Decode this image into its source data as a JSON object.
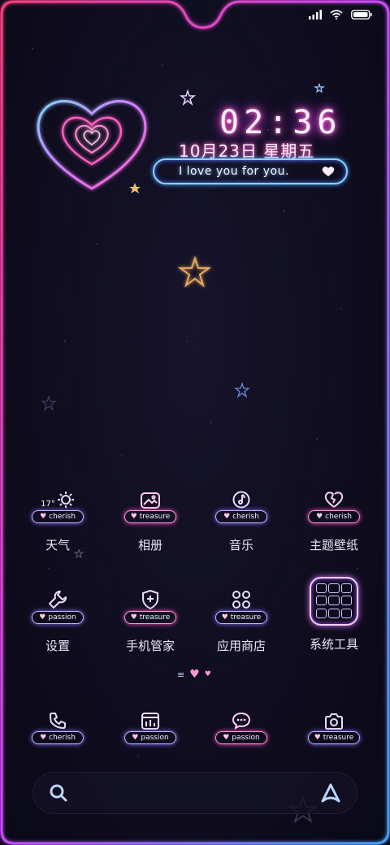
{
  "lock": {
    "time": "02:36",
    "date": "10月23日  星期五",
    "bubble_text": "I love you for you."
  },
  "weather": {
    "temp": "17°"
  },
  "apps_row1": [
    {
      "label": "天气",
      "tag": "cherish",
      "icon": "sun-icon"
    },
    {
      "label": "相册",
      "tag": "treasure",
      "icon": "image-icon"
    },
    {
      "label": "音乐",
      "tag": "cherish",
      "icon": "music-note-icon"
    },
    {
      "label": "主题壁纸",
      "tag": "cherish",
      "icon": "broken-heart-icon"
    }
  ],
  "apps_row2": [
    {
      "label": "设置",
      "tag": "passion",
      "icon": "wrench-icon"
    },
    {
      "label": "手机管家",
      "tag": "treasure",
      "icon": "shield-plus-icon"
    },
    {
      "label": "应用商店",
      "tag": "treasure",
      "icon": "app-grid-icon"
    },
    {
      "label": "系统工具",
      "tag": "",
      "icon": "folder-icon"
    }
  ],
  "dock": [
    {
      "tag": "cherish",
      "icon": "phone-icon"
    },
    {
      "tag": "passion",
      "icon": "calendar-chart-icon"
    },
    {
      "tag": "passion",
      "icon": "message-icon"
    },
    {
      "tag": "treasure",
      "icon": "camera-icon"
    }
  ],
  "colors": {
    "neon_pink": "#ff4fc4",
    "neon_blue": "#4a8cff",
    "neon_purple": "#8a6cff"
  }
}
